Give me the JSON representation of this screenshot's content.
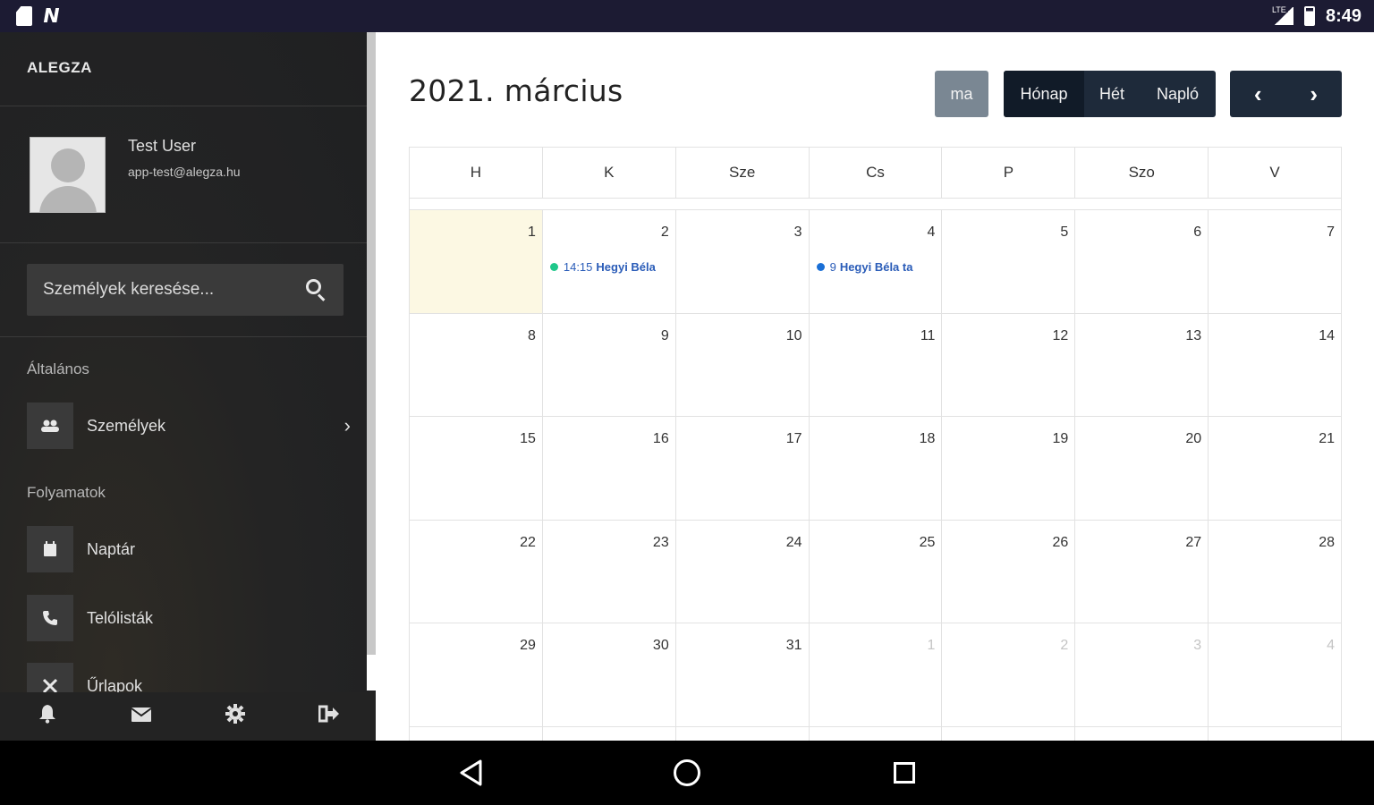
{
  "status_bar": {
    "time": "8:49",
    "network": "LTE"
  },
  "sidebar": {
    "brand": "ALEGZA",
    "user": {
      "name": "Test User",
      "email": "app-test@alegza.hu"
    },
    "search": {
      "placeholder": "Személyek keresése..."
    },
    "sections": [
      {
        "label": "Általános"
      },
      {
        "label": "Folyamatok"
      }
    ],
    "items": [
      {
        "label": "Személyek",
        "icon": "users-icon"
      },
      {
        "label": "Naptár",
        "icon": "calendar-icon"
      },
      {
        "label": "Telólisták",
        "icon": "phone-icon"
      },
      {
        "label": "Űrlapok",
        "icon": "forms-icon"
      }
    ],
    "footer_icons": [
      "bell-icon",
      "envelope-icon",
      "gear-icon",
      "logout-icon"
    ]
  },
  "calendar": {
    "title": "2021. március",
    "today_label": "ma",
    "views": [
      "Hónap",
      "Hét",
      "Napló"
    ],
    "active_view": "Hónap",
    "weekdays": [
      "H",
      "K",
      "Sze",
      "Cs",
      "P",
      "Szo",
      "V"
    ],
    "weeks": [
      [
        "1",
        "2",
        "3",
        "4",
        "5",
        "6",
        "7"
      ],
      [
        "8",
        "9",
        "10",
        "11",
        "12",
        "13",
        "14"
      ],
      [
        "15",
        "16",
        "17",
        "18",
        "19",
        "20",
        "21"
      ],
      [
        "22",
        "23",
        "24",
        "25",
        "26",
        "27",
        "28"
      ],
      [
        "29",
        "30",
        "31",
        "1",
        "2",
        "3",
        "4"
      ]
    ],
    "events": [
      {
        "time": "14:15",
        "title": "Hegyi Béla",
        "color": "#1fc78a"
      },
      {
        "time": "9",
        "title": "Hegyi Béla ta",
        "color": "#1a6fd6"
      }
    ]
  },
  "colors": {
    "status_bar": "#1c1b33",
    "sidebar_bg": "#242424",
    "today_bg": "#fcf8e3",
    "button_dark": "#1e2a3a",
    "button_today": "#7a8793",
    "event_text": "#2a5cb8"
  }
}
